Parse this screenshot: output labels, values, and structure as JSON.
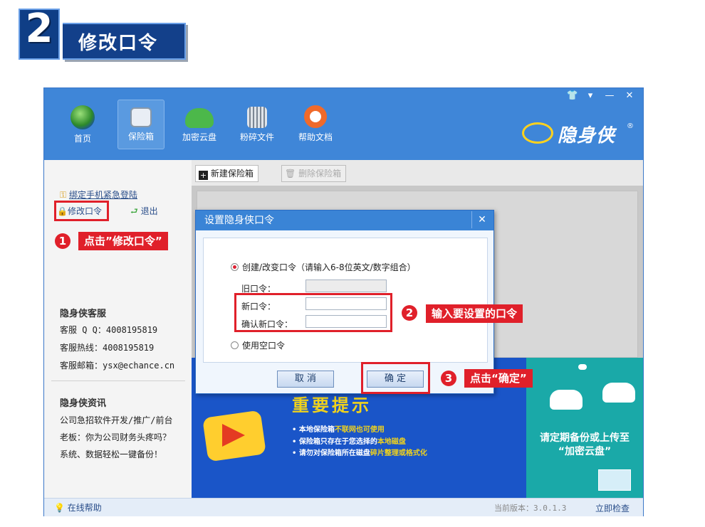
{
  "step": {
    "number": "2",
    "title": "修改口令"
  },
  "window_controls": [
    "👕",
    "▾",
    "—",
    "✕"
  ],
  "nav": [
    {
      "label": "首页",
      "icon": "globe-icon"
    },
    {
      "label": "保险箱",
      "icon": "safe-icon"
    },
    {
      "label": "加密云盘",
      "icon": "cloud-lock-icon"
    },
    {
      "label": "粉碎文件",
      "icon": "shredder-icon"
    },
    {
      "label": "帮助文档",
      "icon": "lifebuoy-icon"
    }
  ],
  "logo": {
    "text": "隐身侠",
    "mark": "e YSX",
    "reg": "®"
  },
  "sidebar": {
    "bind_phone": "绑定手机紧急登陆",
    "change_password": "修改口令",
    "logout": "退出",
    "service_heading": "隐身侠客服",
    "service_qq": "客服 Q Q：4008195819",
    "service_hotline": "客服热线：4008195819",
    "service_email": "客服邮箱：ysx@echance.cn",
    "news_heading": "隐身侠资讯",
    "news_1": "公司急招软件开发/推广/前台",
    "news_2": "老板：你为公司财务头疼吗？",
    "news_3": "系统、数据轻松一键备份！"
  },
  "toolbar": {
    "new_safe": "新建保险箱",
    "delete_safe": "删除保险箱"
  },
  "dialog": {
    "title": "设置隐身侠口令",
    "close": "✕",
    "option_create": "创建/改变口令（请输入6-8位英文/数字组合）",
    "old_label": "旧口令：",
    "new_label": "新口令：",
    "confirm_label": "确认新口令：",
    "option_empty": "使用空口令",
    "cancel": "取 消",
    "ok": "确 定"
  },
  "banner": {
    "headline": "重要提示",
    "tip1_prefix": "• 本地保险箱",
    "tip1_highlight": "不联网也可使用",
    "tip2_prefix": "• 保险箱只存在于您选择的",
    "tip2_highlight": "本地磁盘",
    "tip3_prefix": "• 请勿对保险箱所在磁盘",
    "tip3_highlight": "碎片整理或格式化",
    "teal_line1": "请定期备份或上传至",
    "teal_line2": "“加密云盘”"
  },
  "status": {
    "help": "在线帮助",
    "version": "当前版本：3.0.1.3",
    "check": "立即检查"
  },
  "annotations": {
    "a1_num": "1",
    "a1_text": "点击”修改口令”",
    "a2_num": "2",
    "a2_text": "输入要设置的口令",
    "a3_num": "3",
    "a3_text": "点击“确定”"
  },
  "colors": {
    "app_blue": "#3f86d8",
    "annotation_red": "#e0202a",
    "banner_blue": "#1a55c8",
    "banner_teal": "#1aa9a8"
  }
}
